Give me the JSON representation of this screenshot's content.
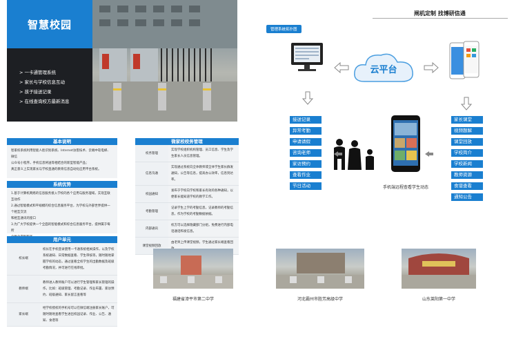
{
  "brand": {
    "title": "智慧校园",
    "slogan": "闸机定制 找博研信通"
  },
  "features": [
    "一卡通管理系统",
    "家长与学校信息互动",
    "孩子接送记录",
    "在线查询校方最新消息"
  ],
  "sections": {
    "basic": {
      "heading": "基本说明",
      "text": [
        "智家校系统利用智能人脸识别系统、Internet访客技术、云端中软电梯、微信",
        "公众号小程序，手机信息将送等相结合的新型智能产品；",
        "真正意义上实现家长与学校直通的教育信息自动化应用平台系统。"
      ]
    },
    "advantages": {
      "heading": "系统优势",
      "items": [
        "1.基于计算机网络的信息服务接入学校的各个应用与服务理域，实现互联互动作",
        "2.通过智能模式和平规模的综合信息服务平台，为学校与外部世界提供一个相互交流",
        "和相互通讯的窗口",
        "3.为广大学校提供一个全面的智能模式和综合信息服务平台，提供属于每所",
        "个性化定制服务",
        "4.校园平台实时监察学生、老师进出记录，家长微信端在线推送孩子的照片及",
        "状态。"
      ]
    },
    "user": {
      "heading": "用户单元",
      "rows": [
        {
          "key": "校长端",
          "value": "校长在手机登录使用一卡通系统相关操作，以及学校系统通知、日常数据查看、学生审核等，随时随地掌握学校的动态，通过查看全校学生的出勤数据及班级考勤情况，并可进行在线审批。"
        },
        {
          "key": "教师端",
          "value": "教师进入教师账户可以进行学生管理和家长管理的操作，比如：班级管理、考勤记录、作业布置、家访预约、班级通知、家长留言查看等"
        },
        {
          "key": "家长端",
          "value": "经学校授权的手机号可以在微信端注册家长账户，可随时随地查看学生进出校园记录、作业、公告、通知、食谱等"
        }
      ]
    },
    "wechat": {
      "heading": "微家校校务管理",
      "rows": [
        {
          "key": "校务管理",
          "value": "实现学校组织机构管理、员工信息、学生及学生家长人员信息管理。"
        },
        {
          "key": "信息沟通",
          "value": "实现通过系统向全体教师或全体学生家长群发通知，公告等信息，提高办公效率，信息到达率。"
        },
        {
          "key": "校园通知",
          "value": "发布于学校向学校和家长有效的各种通知，以便家长能知道学校的教学工作。"
        },
        {
          "key": "考勤管理",
          "value": "记录学生上学的考勤信息，记录教师的考勤信息，作为学校的考勤数据依据。"
        },
        {
          "key": "内部通讯",
          "value": "校方可以选择隐藏部门分组，免费进行内部电话通话和发信息。"
        },
        {
          "key": "课堂视频回放",
          "value": "由老师上传课堂视频，学生通过家长端查看回放"
        }
      ]
    }
  },
  "topology": {
    "tag": "管理系统拓扑图",
    "cloud": "云平台",
    "left_buttons": [
      "接送记录",
      "异常考勤",
      "申请请假",
      "咨询老师",
      "家访预约",
      "查看作业",
      "节日活动"
    ],
    "right_buttons": [
      "家长课堂",
      "视频题解",
      "课堂回放",
      "学校简介",
      "学校新闻",
      "教师资源",
      "食谱查看",
      "通知公告"
    ],
    "phone_caption": "手机端远程查看学生动态"
  },
  "cases": [
    "福建省漳平市第二中学",
    "河北霸州市胜芳高级中学",
    "山东莱阳第一中学"
  ]
}
